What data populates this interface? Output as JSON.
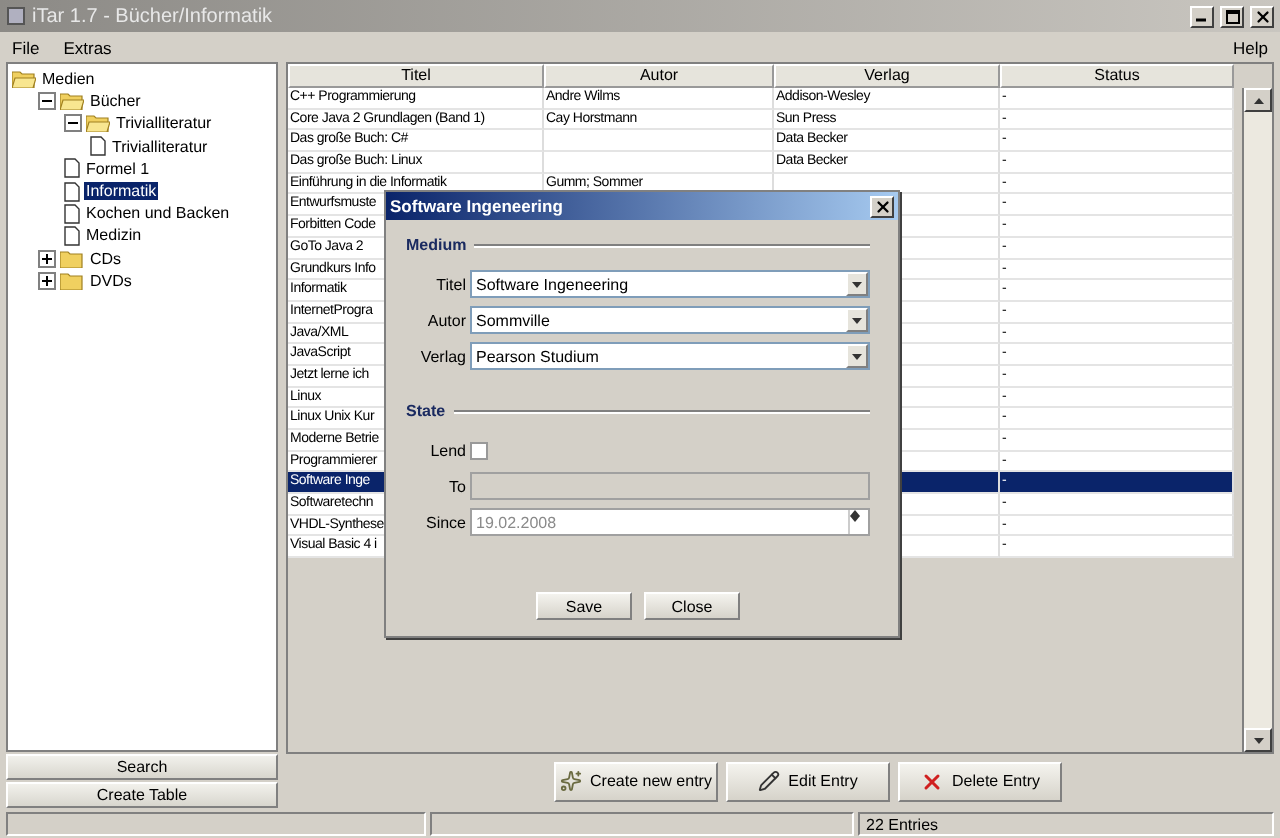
{
  "window": {
    "title": "iTar 1.7 - Bücher/Informatik"
  },
  "menu": {
    "left": [
      "File",
      "Extras"
    ],
    "right": [
      "Help"
    ]
  },
  "tree": [
    {
      "label": "Medien",
      "kind": "folder",
      "expanded": true,
      "selected": false,
      "children": [
        {
          "label": "Bücher",
          "kind": "folder",
          "expanded": true,
          "selected": false,
          "children": [
            {
              "label": "Trivialliteratur",
              "kind": "folder",
              "expanded": true,
              "selected": false,
              "children": [
                {
                  "label": "Trivialliteratur",
                  "kind": "document",
                  "selected": false
                }
              ]
            },
            {
              "label": "Formel 1",
              "kind": "document",
              "selected": false
            },
            {
              "label": "Informatik",
              "kind": "document",
              "selected": true
            },
            {
              "label": "Kochen und Backen",
              "kind": "document",
              "selected": false
            },
            {
              "label": "Medizin",
              "kind": "document",
              "selected": false
            }
          ]
        },
        {
          "label": "CDs",
          "kind": "folder",
          "expanded": false,
          "selected": false
        },
        {
          "label": "DVDs",
          "kind": "folder",
          "expanded": false,
          "selected": false
        }
      ]
    }
  ],
  "side_buttons": [
    "Search",
    "Create Table"
  ],
  "table": {
    "columns": [
      "Titel",
      "Autor",
      "Verlag",
      "Status"
    ],
    "rows": [
      {
        "cells": [
          "C++ Programmierung",
          "Andre Wilms",
          "Addison-Wesley",
          "-"
        ],
        "selected": false
      },
      {
        "cells": [
          "Core Java 2 Grundlagen (Band 1)",
          "Cay Horstmann",
          "Sun Press",
          "-"
        ],
        "selected": false
      },
      {
        "cells": [
          "Das große Buch: C#",
          "",
          "Data Becker",
          "-"
        ],
        "selected": false
      },
      {
        "cells": [
          "Das große Buch: Linux",
          "",
          "Data Becker",
          "-"
        ],
        "selected": false
      },
      {
        "cells": [
          "Einführung in die Informatik",
          "Gumm; Sommer",
          "",
          "-"
        ],
        "selected": false
      },
      {
        "cells": [
          "Entwurfsmuste",
          "",
          "",
          "-"
        ],
        "selected": false
      },
      {
        "cells": [
          "Forbitten Code",
          "",
          "",
          "-"
        ],
        "selected": false
      },
      {
        "cells": [
          "GoTo Java 2",
          "",
          "",
          "-"
        ],
        "selected": false
      },
      {
        "cells": [
          "Grundkurs Info",
          "",
          "",
          "-"
        ],
        "selected": false
      },
      {
        "cells": [
          "Informatik",
          "",
          "",
          "-"
        ],
        "selected": false
      },
      {
        "cells": [
          "InternetProgra",
          "",
          "",
          "-"
        ],
        "selected": false
      },
      {
        "cells": [
          "Java/XML",
          "",
          "",
          "-"
        ],
        "selected": false
      },
      {
        "cells": [
          "JavaScript",
          "",
          "",
          "-"
        ],
        "selected": false
      },
      {
        "cells": [
          "Jetzt lerne ich",
          "",
          "",
          "-"
        ],
        "selected": false
      },
      {
        "cells": [
          "Linux",
          "",
          "",
          "-"
        ],
        "selected": false
      },
      {
        "cells": [
          "Linux Unix Kur",
          "",
          "",
          "-"
        ],
        "selected": false
      },
      {
        "cells": [
          "Moderne Betrie",
          "",
          "",
          "-"
        ],
        "selected": false
      },
      {
        "cells": [
          "Programmierer",
          "",
          "",
          "-"
        ],
        "selected": false
      },
      {
        "cells": [
          "Software Inge",
          "",
          "",
          "-"
        ],
        "selected": true
      },
      {
        "cells": [
          "Softwaretechn",
          "",
          "",
          "-"
        ],
        "selected": false
      },
      {
        "cells": [
          "VHDL-Synthese",
          "",
          "",
          "-"
        ],
        "selected": false
      },
      {
        "cells": [
          "Visual Basic 4 i",
          "",
          "",
          "-"
        ],
        "selected": false
      }
    ]
  },
  "toolbar": [
    {
      "label": "Create new entry",
      "kind": "add"
    },
    {
      "label": "Edit Entry",
      "kind": "edit"
    },
    {
      "label": "Delete Entry",
      "kind": "delete"
    }
  ],
  "status_bar": {
    "entries": "22 Entries"
  },
  "dialog": {
    "title": "Software Ingeneering",
    "medium": {
      "heading": "Medium",
      "fields": [
        {
          "label": "Titel",
          "value": "Software Ingeneering"
        },
        {
          "label": "Autor",
          "value": "Sommville"
        },
        {
          "label": "Verlag",
          "value": "Pearson Studium"
        }
      ]
    },
    "state": {
      "heading": "State",
      "lend": {
        "label": "Lend",
        "checked": false
      },
      "to": {
        "label": "To",
        "disabled": true
      },
      "since": {
        "label": "Since",
        "value": "19.02.2008",
        "disabled": true
      }
    },
    "buttons": [
      "Save",
      "Close"
    ]
  }
}
